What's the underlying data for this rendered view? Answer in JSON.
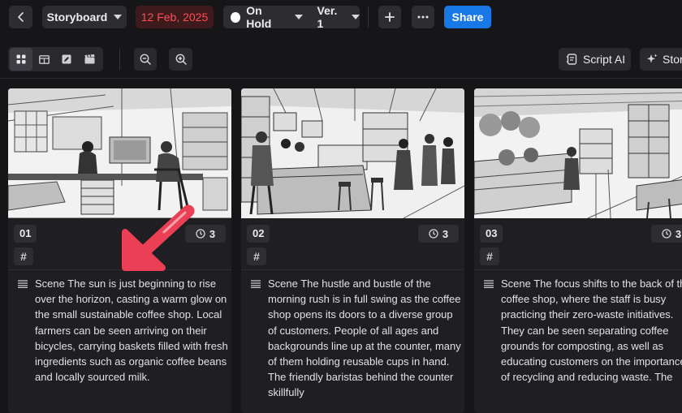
{
  "header": {
    "view_label": "Storyboard",
    "date": "12 Feb, 2025",
    "status": "On Hold",
    "version": "Ver. 1",
    "share_label": "Share"
  },
  "toolbar": {
    "script_ai_label": "Script AI",
    "story_label": "Stor"
  },
  "scenes": [
    {
      "number": "01",
      "duration": "3",
      "tag": "#",
      "description": "Scene The sun is just beginning to rise over the horizon, casting a warm glow on the small sustainable coffee shop. Local farmers can be seen arriving on their bicycles, carrying baskets filled with fresh ingredients such as organic coffee beans and locally sourced milk."
    },
    {
      "number": "02",
      "duration": "3",
      "tag": "#",
      "description": "Scene The hustle and bustle of the morning rush is in full swing as the coffee shop opens its doors to a diverse group of customers. People of all ages and backgrounds line up at the counter, many of them holding reusable cups in hand. The friendly baristas behind the counter skillfully"
    },
    {
      "number": "03",
      "duration": "3",
      "tag": "#",
      "description": "Scene The focus shifts to the back of the coffee shop, where the staff is busy practicing their zero-waste initiatives. They can be seen separating coffee grounds for composting, as well as educating customers on the importance of recycling and reducing waste. The"
    }
  ],
  "colors": {
    "background": "#161618",
    "date_red": "#ff4e55",
    "share_blue": "#1778e6",
    "arrow_red": "#ea3f54"
  }
}
